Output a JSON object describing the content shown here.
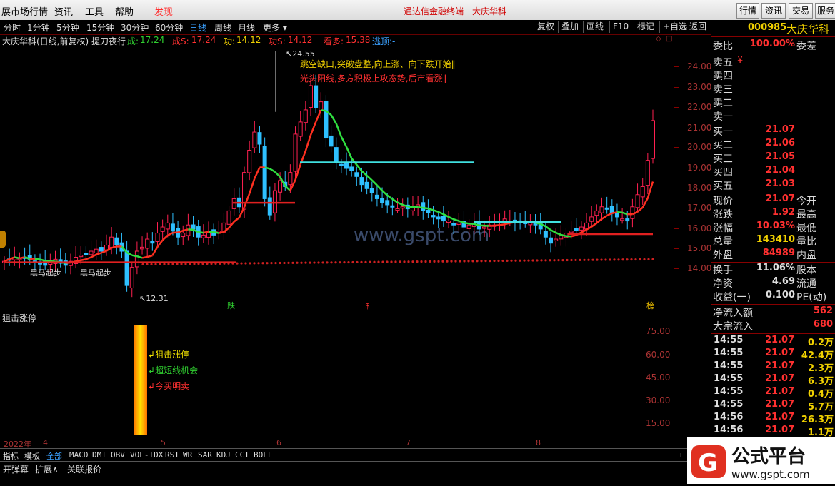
{
  "menubar": {
    "items": [
      "展市场行情",
      "资讯",
      "工具",
      "帮助"
    ],
    "highlight": "发现",
    "center_title": "通达信金融终端",
    "center_stock": "大庆华科",
    "right_buttons": [
      "行情",
      "资讯",
      "交易",
      "服务"
    ]
  },
  "periods": [
    "分时",
    "1分钟",
    "5分钟",
    "15分钟",
    "30分钟",
    "60分钟",
    "日线",
    "周线",
    "月线",
    "更多"
  ],
  "selected_period": "日线",
  "toolbar_buttons": [
    "复权",
    "叠加",
    "画线",
    "F10",
    "标记",
    "+自选",
    "返回"
  ],
  "title_bar": {
    "name": "大庆华科(日线,前复权) 提刀夜行",
    "cheng_label": "成:",
    "cheng_value": "17.24",
    "cheng_s_label": "成S:",
    "cheng_s_value": "17.24",
    "gong_label": "功:",
    "gong_value": "14.12",
    "gong_s_label": "功S:",
    "gong_s_value": "14.12",
    "kanduo_label": "看多:",
    "kanduo_value": "15.38",
    "taoding": "逃顶:-"
  },
  "chart_annotations": {
    "high_label": "24.55",
    "low_label": "12.31",
    "note1": "跳空缺口,突破盘整,向上涨、向下跌开始‖",
    "note2": "光头阳线,多方积极上攻态势,后市看涨‖",
    "heima1": "黑马起步",
    "heima2": "黑马起步",
    "mark_die": "跌",
    "mark_s": "$",
    "mark_bang": "榜",
    "watermark": "www.gspt.com"
  },
  "price_axis": [
    "24.00",
    "23.00",
    "22.00",
    "21.00",
    "20.00",
    "19.00",
    "18.00",
    "17.00",
    "16.00",
    "15.00",
    "14.00"
  ],
  "indicator": {
    "name": "狙击涨停",
    "labels": [
      "狙击涨停",
      "超短线机会",
      "今买明卖"
    ],
    "axis": [
      "75.00",
      "60.00",
      "45.00",
      "30.00",
      "15.00"
    ]
  },
  "time_axis": [
    "2022年",
    "4",
    "5",
    "6",
    "7",
    "8"
  ],
  "indicator_tabs": [
    "指标",
    "模板",
    "全部",
    "MACD",
    "DMI",
    "OBV",
    "VOL-TDX",
    "RSI",
    "WR",
    "SAR",
    "KDJ",
    "CCI",
    "BOLL"
  ],
  "selected_tab": "全部",
  "bottom_buttons": [
    "开弹幕",
    "扩展∧",
    "关联报价"
  ],
  "panel": {
    "code": "000985",
    "name": "大庆华科",
    "weibi_label": "委比",
    "weibi_value": "100.00%",
    "weicha_label": "委差",
    "sell": [
      {
        "label": "卖五",
        "price": "¥",
        "vol": ""
      },
      {
        "label": "卖四",
        "price": "",
        "vol": ""
      },
      {
        "label": "卖三",
        "price": "",
        "vol": ""
      },
      {
        "label": "卖二",
        "price": "",
        "vol": ""
      },
      {
        "label": "卖一",
        "price": "",
        "vol": ""
      }
    ],
    "buy": [
      {
        "label": "买一",
        "price": "21.07"
      },
      {
        "label": "买二",
        "price": "21.06"
      },
      {
        "label": "买三",
        "price": "21.05"
      },
      {
        "label": "买四",
        "price": "21.04"
      },
      {
        "label": "买五",
        "price": "21.03"
      }
    ],
    "stats": [
      {
        "k": "现价",
        "v": "21.07",
        "k2": "今开",
        "color": "red"
      },
      {
        "k": "涨跌",
        "v": "1.92",
        "k2": "最高",
        "color": "red"
      },
      {
        "k": "涨幅",
        "v": "10.03%",
        "k2": "最低",
        "color": "red"
      },
      {
        "k": "总量",
        "v": "143410",
        "k2": "量比",
        "color": "yel"
      },
      {
        "k": "外盘",
        "v": "84989",
        "k2": "内盘",
        "color": "red"
      }
    ],
    "stats2": [
      {
        "k": "换手",
        "v": "11.06%",
        "k2": "股本"
      },
      {
        "k": "净资",
        "v": "4.69",
        "k2": "流通"
      },
      {
        "k": "收益(一)",
        "v": "0.100",
        "k2": "PE(动)"
      }
    ],
    "flows": [
      {
        "k": "净流入额",
        "v": "562"
      },
      {
        "k": "大宗流入",
        "v": "680"
      }
    ],
    "ticks": [
      {
        "t": "14:55",
        "p": "21.07",
        "q": "0.2万"
      },
      {
        "t": "14:55",
        "p": "21.07",
        "q": "42.4万"
      },
      {
        "t": "14:55",
        "p": "21.07",
        "q": "2.3万"
      },
      {
        "t": "14:55",
        "p": "21.07",
        "q": "6.3万"
      },
      {
        "t": "14:55",
        "p": "21.07",
        "q": "0.4万"
      },
      {
        "t": "14:55",
        "p": "21.07",
        "q": "5.7万"
      },
      {
        "t": "14:56",
        "p": "21.07",
        "q": "26.3万"
      },
      {
        "t": "14:56",
        "p": "21.07",
        "q": "1.1万"
      }
    ]
  },
  "logo": {
    "title": "公式平台",
    "url": "www.gspt.com"
  },
  "colors": {
    "up": "#ff2050",
    "down": "#2ec0ff",
    "ma_up": "#ff3020",
    "ma_down": "#30e040",
    "cyan_line": "#40e0e0",
    "red_level": "#e02020"
  }
}
